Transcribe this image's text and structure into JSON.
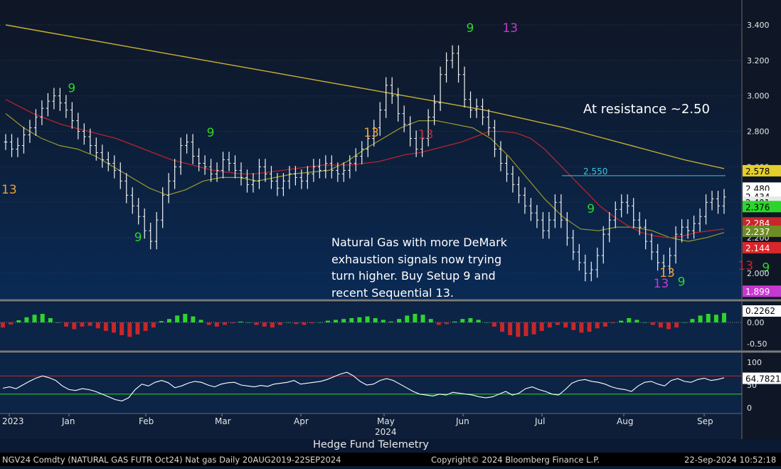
{
  "header": {
    "ticker_info": "NGV24 Comdty (NATURAL GAS FUTR  Oct24) Nat gas  Daily 20AUG2019-22SEP2024",
    "copyright": "Copyright© 2024 Bloomberg Finance L.P.",
    "timestamp": "22-Sep-2024 10:52:18"
  },
  "credit": "Hedge Fund Telemetry",
  "annotations": {
    "resistance": "At resistance ~2.50",
    "note": "Natural Gas with more DeMark\nexhaustion signals now trying\nturn higher.  Buy Setup 9 and\nrecent Sequential 13."
  },
  "colors": {
    "background": "#0b1a33",
    "ma_short": "#b8232a",
    "ma_mid": "#9a9a2a",
    "ma_long": "#c8b032",
    "green_bar": "#2bd62b",
    "red_bar": "#c8262a"
  },
  "chart_data": [
    {
      "type": "ohlc",
      "title": "",
      "y_ticks": [
        "3.400",
        "3.200",
        "3.000",
        "2.800",
        "2.600",
        "2.400",
        "2.200",
        "2.000"
      ],
      "ylim": [
        1.86,
        3.5
      ],
      "x_labels": [
        "2023",
        "Jan",
        "Feb",
        "Mar",
        "Apr",
        "May",
        "Jun",
        "Jul",
        "Aug",
        "Sep"
      ],
      "x_year_label": "2024",
      "close": [
        2.74,
        2.7,
        2.72,
        2.78,
        2.82,
        2.88,
        2.93,
        2.97,
        3.0,
        2.96,
        2.92,
        2.86,
        2.8,
        2.77,
        2.72,
        2.68,
        2.64,
        2.62,
        2.58,
        2.52,
        2.44,
        2.38,
        2.32,
        2.24,
        2.18,
        2.3,
        2.44,
        2.52,
        2.6,
        2.72,
        2.74,
        2.66,
        2.62,
        2.6,
        2.56,
        2.58,
        2.64,
        2.62,
        2.58,
        2.54,
        2.5,
        2.52,
        2.6,
        2.56,
        2.52,
        2.48,
        2.52,
        2.56,
        2.54,
        2.52,
        2.56,
        2.6,
        2.58,
        2.62,
        2.58,
        2.56,
        2.58,
        2.62,
        2.66,
        2.7,
        2.76,
        2.82,
        2.92,
        3.06,
        3.0,
        2.9,
        2.84,
        2.76,
        2.7,
        2.76,
        2.88,
        2.96,
        3.12,
        3.2,
        3.24,
        3.12,
        2.98,
        2.92,
        2.94,
        2.88,
        2.82,
        2.7,
        2.62,
        2.56,
        2.5,
        2.44,
        2.38,
        2.34,
        2.3,
        2.24,
        2.3,
        2.4,
        2.3,
        2.2,
        2.12,
        2.06,
        2.0,
        2.02,
        2.1,
        2.22,
        2.3,
        2.36,
        2.4,
        2.38,
        2.3,
        2.26,
        2.18,
        2.12,
        2.06,
        2.04,
        2.1,
        2.22,
        2.26,
        2.24,
        2.28,
        2.32,
        2.4,
        2.42,
        2.38,
        2.43
      ],
      "ma_short": [
        2.98,
        2.94,
        2.9,
        2.87,
        2.84,
        2.82,
        2.8,
        2.78,
        2.76,
        2.73,
        2.7,
        2.67,
        2.64,
        2.62,
        2.6,
        2.58,
        2.57,
        2.56,
        2.56,
        2.57,
        2.58,
        2.59,
        2.6,
        2.61,
        2.61,
        2.61,
        2.62,
        2.63,
        2.65,
        2.67,
        2.68,
        2.7,
        2.72,
        2.74,
        2.77,
        2.8,
        2.8,
        2.79,
        2.76,
        2.7,
        2.62,
        2.54,
        2.46,
        2.38,
        2.32,
        2.27,
        2.23,
        2.21,
        2.2,
        2.21,
        2.23,
        2.24,
        2.25
      ],
      "ma_mid": [
        2.9,
        2.82,
        2.76,
        2.72,
        2.7,
        2.66,
        2.6,
        2.54,
        2.48,
        2.44,
        2.47,
        2.52,
        2.54,
        2.54,
        2.52,
        2.54,
        2.56,
        2.57,
        2.58,
        2.63,
        2.7,
        2.76,
        2.82,
        2.86,
        2.86,
        2.84,
        2.82,
        2.76,
        2.66,
        2.54,
        2.42,
        2.32,
        2.25,
        2.24,
        2.26,
        2.26,
        2.24,
        2.2,
        2.18,
        2.2,
        2.23
      ],
      "ma_long": [
        3.4,
        3.36,
        3.32,
        3.28,
        3.24,
        3.2,
        3.16,
        3.12,
        3.08,
        3.04,
        3.0,
        2.96,
        2.92,
        2.87,
        2.82,
        2.76,
        2.7,
        2.64,
        2.59
      ],
      "last_values": [
        {
          "value": 2.578,
          "label": "2.578",
          "color": "#e5cf2a"
        },
        {
          "value": 2.48,
          "label": "2.480",
          "color": "#ffffff"
        },
        {
          "value": 2.434,
          "label": "2.434",
          "color": "#ffffff"
        },
        {
          "value": 2.401,
          "label": "2.401",
          "color": "#e8e8e8"
        },
        {
          "value": 2.376,
          "label": "2.376",
          "color": "#2bd62b"
        },
        {
          "value": 2.284,
          "label": "2.284",
          "color": "#c8262a"
        },
        {
          "value": 2.237,
          "label": "2.237",
          "color": "#6f8d24"
        },
        {
          "value": 2.144,
          "label": "2.144",
          "color": "#d9262a"
        },
        {
          "value": 1.899,
          "label": "1.899",
          "color": "#c737d1"
        }
      ],
      "levels": [
        {
          "value": 2.55,
          "label": "2.550",
          "color": "#38c8e0"
        }
      ],
      "demark_labels": [
        {
          "i": 0,
          "price": 2.45,
          "text": "13",
          "color": "#f0a030"
        },
        {
          "i": 11,
          "price": 3.02,
          "text": "9",
          "color": "#2bd62b"
        },
        {
          "i": 34,
          "price": 2.77,
          "text": "9",
          "color": "#2bd62b"
        },
        {
          "i": 22,
          "price": 2.18,
          "text": "9",
          "color": "#2bd62b"
        },
        {
          "i": 60,
          "price": 2.77,
          "text": "13",
          "color": "#f0a030"
        },
        {
          "i": 69,
          "price": 2.76,
          "text": "13",
          "color": "#c8262a"
        },
        {
          "i": 77,
          "price": 3.36,
          "text": "9",
          "color": "#2bd62b"
        },
        {
          "i": 83,
          "price": 3.36,
          "text": "13",
          "color": "#c737d1"
        },
        {
          "i": 97,
          "price": 2.34,
          "text": "9",
          "color": "#2bd62b"
        },
        {
          "i": 109,
          "price": 1.98,
          "text": "13",
          "color": "#f0a030"
        },
        {
          "i": 108,
          "price": 1.92,
          "text": "13",
          "color": "#c737d1"
        },
        {
          "i": 112,
          "price": 1.93,
          "text": "9",
          "color": "#2bd62b"
        },
        {
          "i": 122,
          "price": 2.02,
          "text": "13",
          "color": "#c8262a"
        },
        {
          "i": 126,
          "price": 2.01,
          "text": "9",
          "color": "#2bd62b"
        }
      ]
    },
    {
      "type": "bar",
      "title": "",
      "y_ticks": [
        "0.00",
        "-0.50"
      ],
      "ylim": [
        -0.62,
        0.3
      ],
      "last_value": {
        "value": 0.2262,
        "label": "0.2262"
      },
      "values": [
        -0.12,
        -0.05,
        0.05,
        0.12,
        0.18,
        0.2,
        0.1,
        0.0,
        -0.1,
        -0.16,
        -0.1,
        -0.08,
        -0.14,
        -0.2,
        -0.24,
        -0.3,
        -0.34,
        -0.28,
        -0.2,
        -0.12,
        0.03,
        0.08,
        0.16,
        0.2,
        0.14,
        0.06,
        -0.06,
        -0.1,
        -0.06,
        -0.02,
        0.02,
        0.0,
        -0.06,
        -0.1,
        -0.12,
        -0.06,
        0.0,
        -0.04,
        -0.06,
        -0.02,
        0.0,
        0.04,
        0.06,
        0.08,
        0.1,
        0.12,
        0.14,
        0.1,
        0.06,
        0.02,
        0.08,
        0.16,
        0.2,
        0.18,
        0.08,
        -0.06,
        -0.04,
        0.02,
        0.08,
        0.1,
        0.06,
        0.0,
        -0.1,
        -0.22,
        -0.3,
        -0.34,
        -0.32,
        -0.28,
        -0.2,
        -0.12,
        -0.06,
        -0.12,
        -0.18,
        -0.24,
        -0.22,
        -0.14,
        -0.1,
        -0.02,
        0.04,
        0.1,
        0.06,
        0.0,
        -0.06,
        -0.12,
        -0.16,
        -0.12,
        0.0,
        0.08,
        0.16,
        0.2,
        0.18,
        0.22
      ]
    },
    {
      "type": "line",
      "title": "",
      "y_ticks": [
        "100",
        "50",
        "0"
      ],
      "ylim": [
        0,
        100
      ],
      "hlines": [
        70,
        30
      ],
      "last_value": {
        "value": 64.7821,
        "label": "64.7821"
      },
      "values": [
        43,
        46,
        42,
        50,
        58,
        65,
        70,
        66,
        60,
        48,
        40,
        38,
        42,
        40,
        36,
        30,
        24,
        18,
        15,
        22,
        40,
        52,
        48,
        56,
        60,
        55,
        44,
        48,
        54,
        58,
        56,
        50,
        46,
        52,
        55,
        56,
        50,
        48,
        46,
        49,
        47,
        52,
        54,
        56,
        60,
        52,
        54,
        56,
        58,
        62,
        68,
        74,
        78,
        70,
        58,
        50,
        52,
        60,
        64,
        60,
        52,
        44,
        36,
        30,
        28,
        26,
        30,
        28,
        34,
        32,
        30,
        28,
        24,
        22,
        24,
        30,
        36,
        28,
        32,
        42,
        46,
        40,
        36,
        30,
        28,
        40,
        54,
        60,
        62,
        58,
        56,
        52,
        46,
        42,
        40,
        36,
        48,
        56,
        58,
        52,
        48,
        60,
        64,
        58,
        56,
        62,
        65,
        60,
        62,
        66
      ]
    }
  ]
}
